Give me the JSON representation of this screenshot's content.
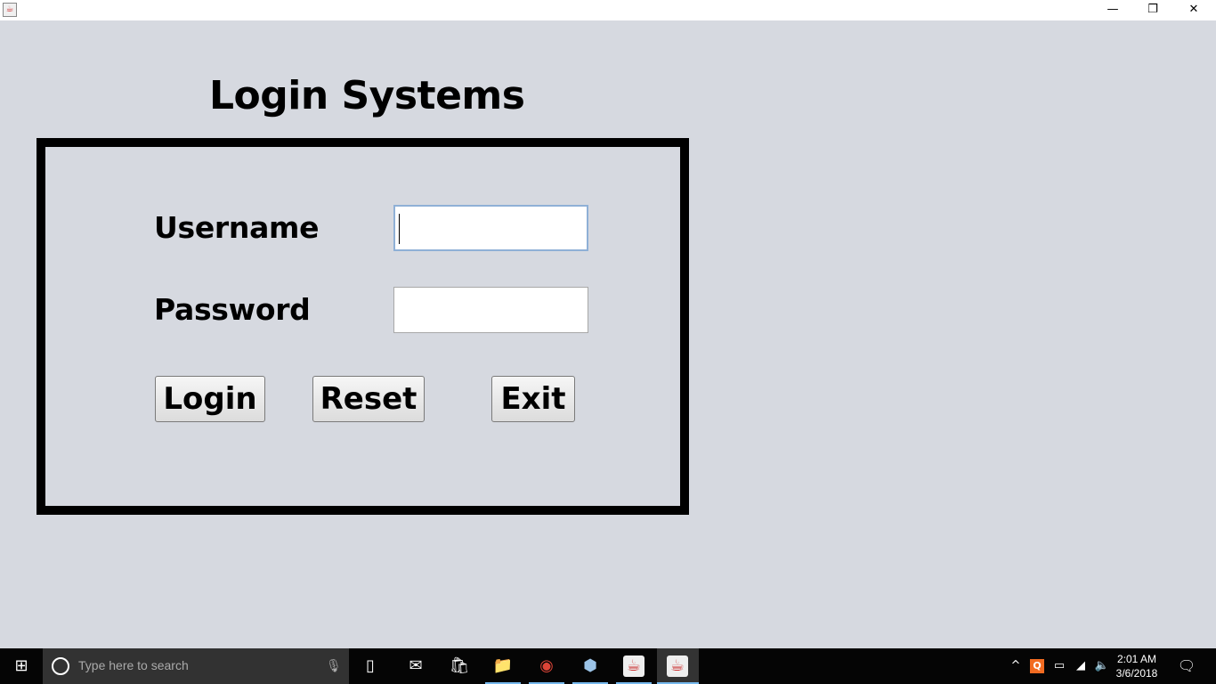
{
  "window": {
    "minimize": "—",
    "restore": "❐",
    "close": "✕",
    "app_icon": "java-icon"
  },
  "form": {
    "title": "Login Systems",
    "username_label": "Username",
    "username_value": "",
    "password_label": "Password",
    "password_value": "",
    "buttons": {
      "login": "Login",
      "reset": "Reset",
      "exit": "Exit"
    }
  },
  "taskbar": {
    "search_placeholder": "Type here to search",
    "time": "2:01 AM",
    "date": "3/6/2018",
    "pinned": [
      "task-view",
      "mail",
      "store",
      "file-explorer",
      "chrome",
      "virtualbox",
      "java",
      "java"
    ]
  },
  "colors": {
    "background": "#d6d9e0",
    "focus_border": "#8fb0d6",
    "taskbar": "#050505"
  }
}
